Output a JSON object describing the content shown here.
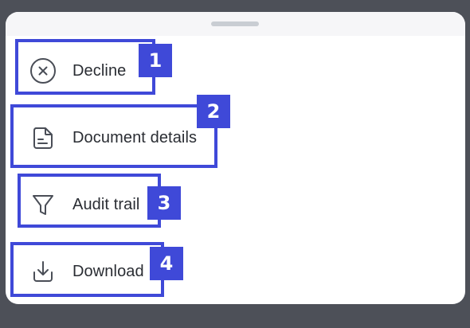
{
  "menu": {
    "items": [
      {
        "label": "Decline",
        "icon": "x-circle-icon"
      },
      {
        "label": "Document details",
        "icon": "document-icon"
      },
      {
        "label": "Audit trail",
        "icon": "filter-icon"
      },
      {
        "label": "Download",
        "icon": "download-icon"
      }
    ]
  },
  "annotations": [
    "1",
    "2",
    "3",
    "4"
  ],
  "colors": {
    "overlay": "#4d5058",
    "sheet": "#ffffff",
    "annotation": "#3f49d8",
    "text": "#2a2d33",
    "icon": "#4a4e57"
  }
}
